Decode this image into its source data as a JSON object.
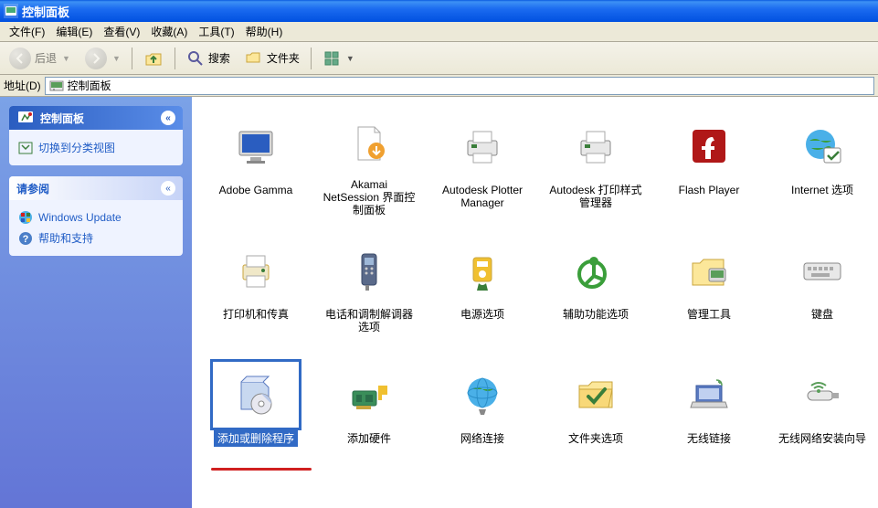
{
  "window": {
    "title": "控制面板"
  },
  "menu": {
    "file": "文件(F)",
    "edit": "编辑(E)",
    "view": "查看(V)",
    "favorites": "收藏(A)",
    "tools": "工具(T)",
    "help": "帮助(H)"
  },
  "toolbar": {
    "back": "后退",
    "search": "搜索",
    "folders": "文件夹"
  },
  "address": {
    "label": "地址(D)",
    "value": "控制面板"
  },
  "sidebar": {
    "cp_header": "控制面板",
    "switch_view": "切换到分类视图",
    "see_also": "请参阅",
    "links": [
      {
        "label": "Windows Update"
      },
      {
        "label": "帮助和支持"
      }
    ]
  },
  "items": [
    {
      "name": "adobe-gamma",
      "label": "Adobe Gamma",
      "icon": "monitor"
    },
    {
      "name": "akamai",
      "label": "Akamai NetSession 界面控制面板",
      "icon": "doc-down"
    },
    {
      "name": "autodesk-plotter",
      "label": "Autodesk Plotter Manager",
      "icon": "plotter"
    },
    {
      "name": "autodesk-printstyle",
      "label": "Autodesk 打印样式管理器",
      "icon": "plotter"
    },
    {
      "name": "flash",
      "label": "Flash Player",
      "icon": "flash"
    },
    {
      "name": "internet-options",
      "label": "Internet 选项",
      "icon": "globe-check"
    },
    {
      "name": "printers-faxes",
      "label": "打印机和传真",
      "icon": "printer"
    },
    {
      "name": "phone-modem",
      "label": "电话和调制解调器选项",
      "icon": "phone"
    },
    {
      "name": "power-options",
      "label": "电源选项",
      "icon": "power"
    },
    {
      "name": "accessibility",
      "label": "辅助功能选项",
      "icon": "accessibility"
    },
    {
      "name": "admin-tools",
      "label": "管理工具",
      "icon": "admin"
    },
    {
      "name": "keyboard",
      "label": "键盘",
      "icon": "keyboard"
    },
    {
      "name": "add-remove",
      "label": "添加或删除程序",
      "icon": "box-cd",
      "selected": true,
      "redline": true
    },
    {
      "name": "add-hardware",
      "label": "添加硬件",
      "icon": "hardware"
    },
    {
      "name": "network-connections",
      "label": "网络连接",
      "icon": "globe-net"
    },
    {
      "name": "folder-options",
      "label": "文件夹选项",
      "icon": "folder-check"
    },
    {
      "name": "wireless-link",
      "label": "无线链接",
      "icon": "laptop-wifi"
    },
    {
      "name": "wireless-setup",
      "label": "无线网络安装向导",
      "icon": "usb-wifi"
    }
  ]
}
